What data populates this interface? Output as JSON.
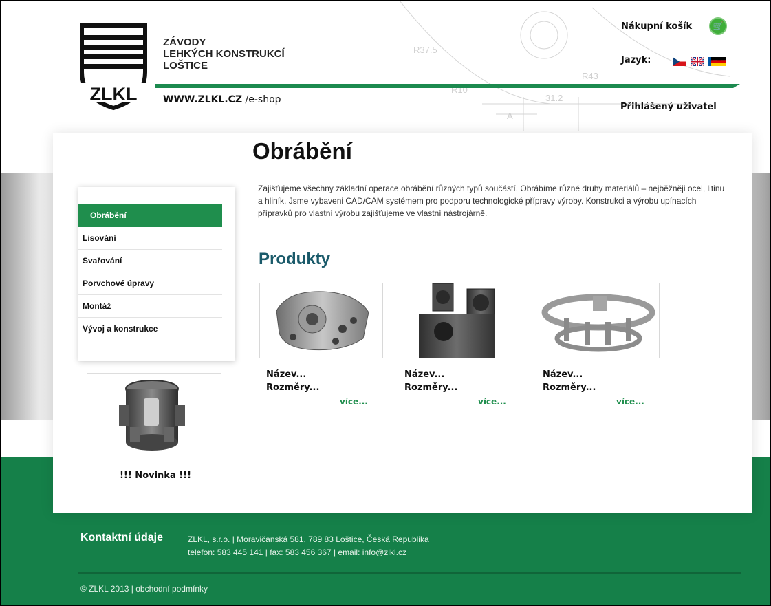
{
  "header": {
    "brand_line1": "ZÁVODY",
    "brand_line2": "LEHKÝCH KONSTRUKCÍ",
    "brand_line3": "LOŠTICE",
    "logo_text": "ZLKL",
    "web_domain": "WWW.ZLKL.CZ",
    "web_suffix": "/e-shop",
    "cart_label": "Nákupní košík",
    "language_label": "Jazyk:",
    "user_label": "Přihlášený uživatel",
    "drawing_labels": [
      "R37.5",
      "R43",
      "R10",
      "31.2",
      "A"
    ]
  },
  "main": {
    "title": "Obrábění",
    "intro": "Zajišťujeme všechny základní operace obrábění různých typů součástí. Obrábíme různé druhy materiálů – nejběžněji ocel, litinu a hliník. Jsme vybaveni CAD/CAM systémem pro podporu technologické přípravy výroby. Konstrukci a výrobu upínacích přípravků pro vlastní výrobu zajišťujeme ve vlastní nástrojárně.",
    "products_title": "Produkty",
    "products": [
      {
        "name": "Název...",
        "dimensions": "Rozměry...",
        "more": "více..."
      },
      {
        "name": "Název...",
        "dimensions": "Rozměry...",
        "more": "více..."
      },
      {
        "name": "Název...",
        "dimensions": "Rozměry...",
        "more": "více..."
      }
    ]
  },
  "sidebar": {
    "items": [
      {
        "label": "Obrábění",
        "active": true
      },
      {
        "label": "Lisování",
        "active": false
      },
      {
        "label": "Svařování",
        "active": false
      },
      {
        "label": "Porvchové úpravy",
        "active": false
      },
      {
        "label": "Montáž",
        "active": false
      },
      {
        "label": "Vývoj a konstrukce",
        "active": false
      }
    ],
    "news_label": "!!! Novinka !!!"
  },
  "footer": {
    "contacts_title": "Kontaktní údaje",
    "contacts_line1": "ZLKL, s.r.o. | Moravičanská 581, 789 83 Loštice, Česká Republika",
    "contacts_line2": "telefon: 583 445 141 | fax: 583 456 367 | email: info@zlkl.cz",
    "copyright": "© ZLKL 2013",
    "separator": " | ",
    "terms": "obchodní podmínky"
  },
  "colors": {
    "brand_green": "#1f8e4d",
    "footer_green": "#158049",
    "heading_teal": "#1a5a6a"
  }
}
